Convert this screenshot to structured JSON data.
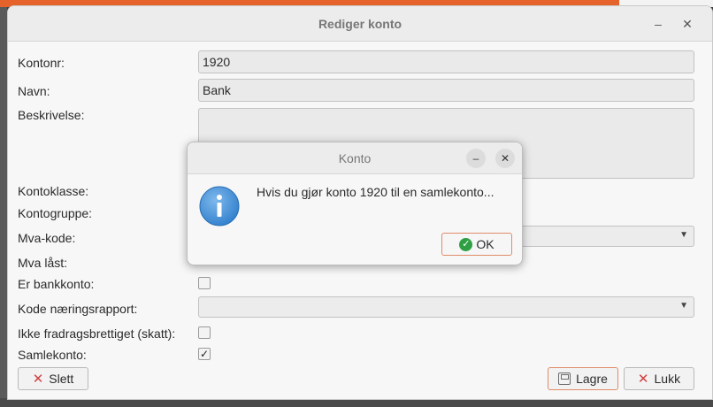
{
  "main_window": {
    "title": "Rediger konto",
    "labels": {
      "kontonr": "Kontonr:",
      "navn": "Navn:",
      "beskrivelse": "Beskrivelse:",
      "kontoklasse": "Kontoklasse:",
      "kontogruppe": "Kontogruppe:",
      "mva_kode": "Mva-kode:",
      "mva_last": "Mva låst:",
      "er_bankkonto": "Er bankkonto:",
      "kode_naeringsrapport": "Kode næringsrapport:",
      "ikke_fradragsberettiget": "Ikke fradragsbrettiget (skatt):",
      "samlekonto": "Samlekonto:"
    },
    "values": {
      "kontonr": "1920",
      "navn": "Bank",
      "beskrivelse": "",
      "er_bankkonto_checked": false,
      "ikke_fradragsberettiget_checked": false,
      "samlekonto_check_mark": "✓"
    },
    "buttons": {
      "slett": "Slett",
      "lagre": "Lagre",
      "lukk": "Lukk"
    }
  },
  "dialog": {
    "title": "Konto",
    "message": "Hvis du gjør konto 1920 til en samlekonto...",
    "ok_label": "OK",
    "icon": "info-icon"
  },
  "colors": {
    "accent_orange": "#e5632a",
    "default_button_border": "#e08c6a",
    "info_blue": "#3d8fd6",
    "ok_green": "#2ea043",
    "delete_red": "#d04040"
  }
}
